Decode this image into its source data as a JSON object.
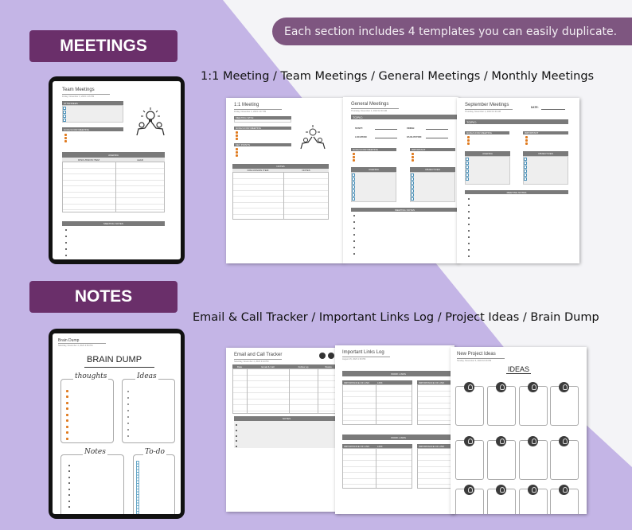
{
  "colors": {
    "lavender": "#c4b5e6",
    "white_band": "#f4f4f7",
    "badge": "#6a2f6a",
    "pill": "#7e5680",
    "bar_gray": "#7a7a7a",
    "bullet_orange": "#e07a1e",
    "checkbox_blue": "#4a90b8"
  },
  "header": {
    "info_pill": "Each section includes 4 templates you can easily duplicate."
  },
  "meetings": {
    "badge": "MEETINGS",
    "subtitle": "1:1 Meeting / Team Meetings / General Meetings / Monthly Meetings",
    "tablet_page": {
      "title": "Team Meetings",
      "date": "Friday, November 3, 2023     1:16 PM",
      "attendees": "ATTENDEES",
      "goals": "GOALS FOR MEETING",
      "agenda": "AGENDA",
      "col_discussion": "DISCUSSION ITEM",
      "col_lead": "LEAD",
      "notes": "MEETING NOTES"
    },
    "pages": [
      {
        "title": "1:1 Meeting",
        "date": "Friday, November 3, 2023     1:37 PM",
        "meeting_with": "MEETING WITH:",
        "goals": "GOALS FOR MEETING",
        "key_points": "KEY POINTS",
        "notes": "NOTES",
        "col_discussion": "DISCUSSION ITEM",
        "col_notes": "NOTES"
      },
      {
        "title": "General Meetings",
        "date": "Thursday, November 2, 2023     10:33 AM",
        "topic": "TOPIC:",
        "start": "START:",
        "finish": "FINISH:",
        "location": "LOCATION:",
        "facilitator": "FACILITATOR:",
        "goals": "GOALS FOR MEETING",
        "important": "IMPORTANT",
        "agenda": "AGENDA",
        "objectives": "OBJECTIVES",
        "notes": "MEETING NOTES"
      },
      {
        "title": "September Meetings",
        "date": "Thursday, November 2, 2023     10:33 AM",
        "date_label": "DATE:",
        "topic": "TOPIC:",
        "goals": "GOALS FOR MEETING",
        "important": "IMPORTANT",
        "agenda": "AGENDA",
        "objectives": "OBJECTIVES",
        "notes": "MEETING NOTES"
      }
    ]
  },
  "notes": {
    "badge": "NOTES",
    "subtitle": "Email & Call Tracker / Important Links Log / Project Ideas / Brain Dump",
    "tablet_page": {
      "title": "Brain Dump",
      "date": "Saturday, November 4, 2023     3:50 PM",
      "heading": "BRAIN DUMP",
      "thoughts": "thoughts",
      "ideas": "Ideas",
      "notes": "Notes",
      "todo": "To-do"
    },
    "pages": [
      {
        "title": "Email and Call Tracker",
        "date": "Saturday, November 4, 2023     3:44 PM",
        "cols": [
          "Date",
          "Email & Call",
          "Follow up",
          "Status"
        ],
        "notes": "NOTES"
      },
      {
        "title": "Important Links Log",
        "date": "August 15, 2023     1:36 PM",
        "section1": "WORK LINKS",
        "section2": "WORK LINKS",
        "col_importance": "IMPORTANCE OF LINK",
        "col_link": "LINK"
      },
      {
        "title": "New Project Ideas",
        "date": "Sunday, November 5, 2023     10:29 PM",
        "heading": "IDEAS"
      }
    ]
  }
}
